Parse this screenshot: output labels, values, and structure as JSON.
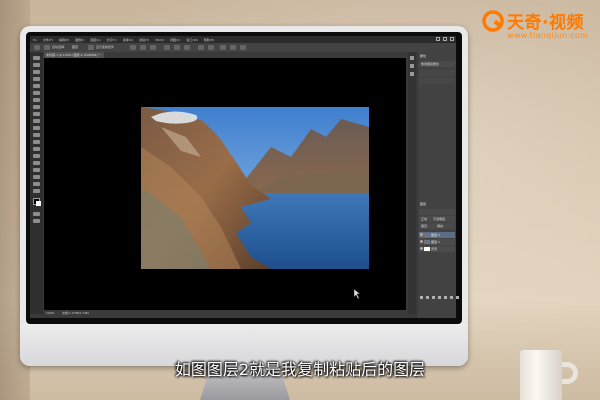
{
  "photoshop": {
    "menu": [
      "Ps",
      "文件(F)",
      "编辑(E)",
      "图像(I)",
      "图层(L)",
      "文字(Y)",
      "选择(S)",
      "滤镜(T)",
      "3D(D)",
      "视图(V)",
      "窗口(W)",
      "帮助(H)"
    ],
    "options_bar": {
      "text1": "自动选择:",
      "text2": "图层",
      "text3": "显示变换控件"
    },
    "document_tab": "未标题-1 @ 100% (图层 2, RGB/8#) *",
    "status": {
      "zoom": "100%",
      "doc_info": "文档:1.37M/2.74M"
    },
    "panels": {
      "properties_title": "属性",
      "properties_item": "像素图层属性",
      "layers_title": "图层",
      "blend_mode": "正常",
      "opacity_label": "不透明度:",
      "lock_label": "锁定:",
      "fill_label": "填充:",
      "layers": [
        {
          "name": "图层 2",
          "selected": true
        },
        {
          "name": "图层 1",
          "selected": false
        },
        {
          "name": "背景",
          "selected": false
        }
      ]
    }
  },
  "logo": {
    "name": "天奇·视频",
    "url": "www.tianqijun.com"
  },
  "caption": "如图图层2就是我复制粘贴后的图层",
  "colors": {
    "brand": "#ff7a00",
    "ps_dark": "#2b2b2b",
    "ps_panel": "#424242",
    "selection": "#5b6e86"
  }
}
